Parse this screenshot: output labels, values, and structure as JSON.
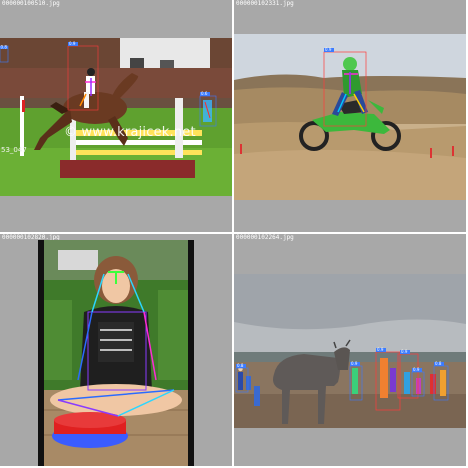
{
  "tiles": [
    {
      "filename": "000000100510.jpg",
      "watermark": "© www.krajicek.net",
      "corner_label": "53_047",
      "detections": [
        {
          "score": "0.8"
        },
        {
          "score": "0.9"
        },
        {
          "score": "0.6"
        }
      ]
    },
    {
      "filename": "000000102331.jpg",
      "detections": [
        {
          "score": "0.9"
        }
      ]
    },
    {
      "filename": "000000102820.jpg",
      "detections": []
    },
    {
      "filename": "000000102264.jpg",
      "detections": [
        {
          "score": "0.8"
        },
        {
          "score": "0.9"
        },
        {
          "score": "0.9"
        },
        {
          "score": "0.9"
        },
        {
          "score": "0.9"
        },
        {
          "score": "0.8"
        }
      ]
    }
  ],
  "colors": {
    "panel_bg": "#a8a8a8",
    "box_red": "#ff3b3b",
    "box_blue": "#3b7bff",
    "label_bg": "#3b7bff"
  }
}
